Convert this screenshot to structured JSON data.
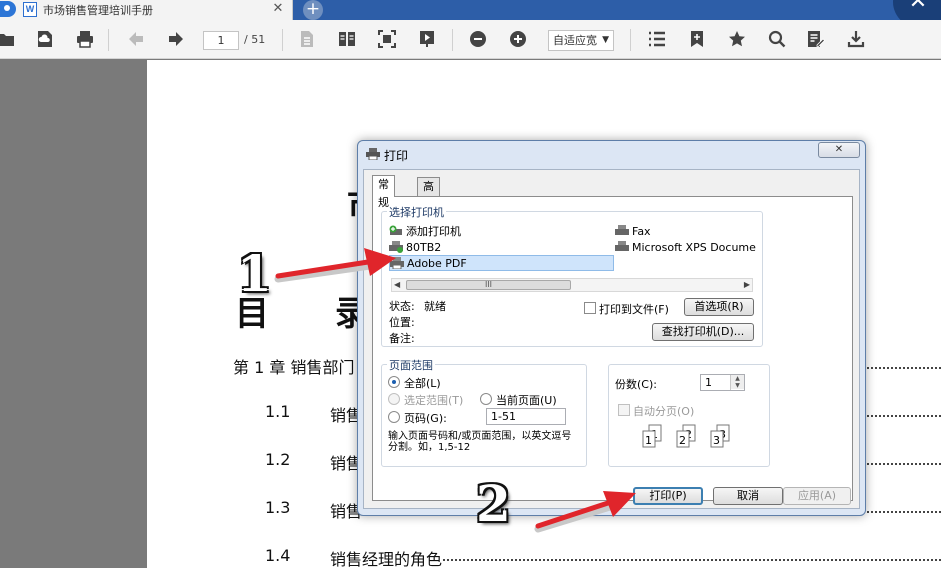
{
  "tab": {
    "title": "市场销售管理培训手册",
    "file_icon": "W"
  },
  "toolbar": {
    "page_current": "1",
    "page_total": "/ 51",
    "zoom": "自适应宽"
  },
  "document": {
    "heading_frag_1": "目",
    "heading_frag_2": "录",
    "heading_frag_3": "市",
    "toc": [
      {
        "num": "",
        "text": "第 1 章  销售部门"
      },
      {
        "num": "1.1",
        "text": "销售"
      },
      {
        "num": "1.2",
        "text": "销售"
      },
      {
        "num": "1.3",
        "text": "销售"
      },
      {
        "num": "1.4",
        "text": "销售经理的角色"
      }
    ]
  },
  "dialog": {
    "title": "打印",
    "close_glyph": "✕",
    "tabs": [
      "常规",
      "高级"
    ],
    "select_printer_label": "选择打印机",
    "printers": [
      "添加打印机",
      "80TB2",
      "Adobe PDF",
      "Fax",
      "Microsoft XPS Docume"
    ],
    "status_label": "状态:",
    "status_value": "就绪",
    "location_label": "位置:",
    "comment_label": "备注:",
    "print_to_file": "打印到文件(F)",
    "preferences_btn": "首选项(R)",
    "find_printer_btn": "查找打印机(D)...",
    "page_range_label": "页面范围",
    "range_all": "全部(L)",
    "range_selection": "选定范围(T)",
    "range_current": "当前页面(U)",
    "range_pages": "页码(G):",
    "pages_value": "1-51",
    "range_hint": "输入页面号码和/或页面范围，以英文逗号分割。如，1,5-12",
    "copies_label": "份数(C):",
    "copies_value": "1",
    "collate_label": "自动分页(O)",
    "print_btn": "打印(P)",
    "cancel_btn": "取消",
    "apply_btn": "应用(A)",
    "scroll_thumb": "III"
  },
  "annotations": {
    "step1": "1",
    "step2": "2"
  },
  "colors": {
    "tabbar": "#2d5ea8",
    "arrow": "#e0252b",
    "dialog_frame": "#dce6f4"
  }
}
